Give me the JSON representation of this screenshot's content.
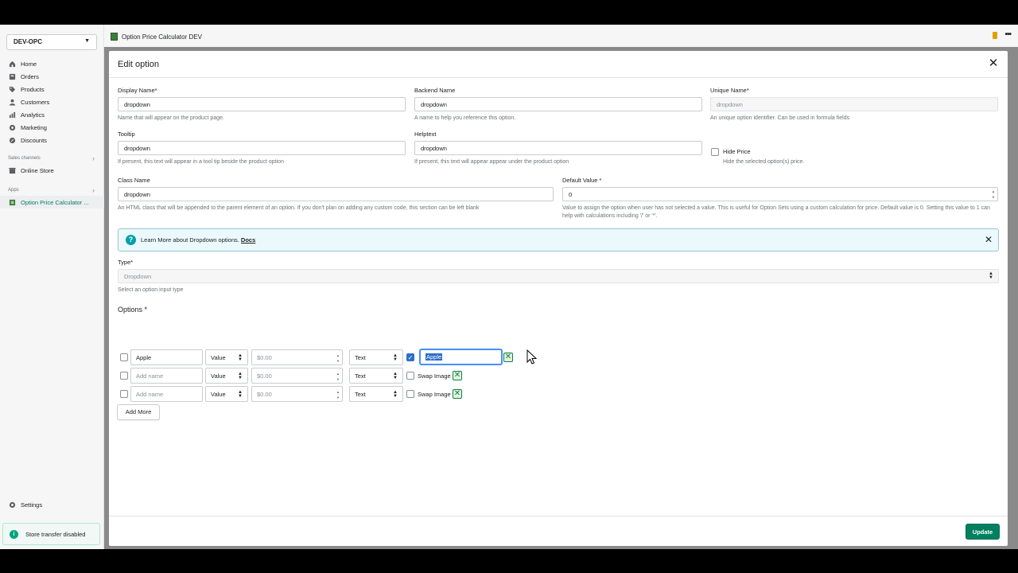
{
  "sidebar": {
    "store": "DEV-OPC",
    "items": [
      {
        "label": "Home",
        "icon": "home-icon"
      },
      {
        "label": "Orders",
        "icon": "orders-icon"
      },
      {
        "label": "Products",
        "icon": "tag-icon"
      },
      {
        "label": "Customers",
        "icon": "person-icon"
      },
      {
        "label": "Analytics",
        "icon": "analytics-icon"
      },
      {
        "label": "Marketing",
        "icon": "marketing-icon"
      },
      {
        "label": "Discounts",
        "icon": "discount-icon"
      }
    ],
    "sales_channels_label": "Sales channels",
    "online_store": "Online Store",
    "apps_label": "Apps",
    "app_item": "Option Price Calculator ...",
    "settings": "Settings",
    "store_transfer": "Store transfer disabled"
  },
  "appbar": {
    "title": "Option Price Calculator DEV"
  },
  "modal": {
    "title": "Edit option",
    "display_name": {
      "label": "Display Name*",
      "value": "dropdown",
      "help": "Name that will appear on the product page."
    },
    "backend_name": {
      "label": "Backend Name",
      "value": "dropdown",
      "help": "A name to help you reference this option."
    },
    "unique_name": {
      "label": "Unique Name*",
      "value": "dropdown",
      "help": "An unique option identifier. Can be used in formula fields"
    },
    "tooltip": {
      "label": "Tooltip",
      "value": "dropdown",
      "help": "If present, this text will appear in a tool tip beside the product option"
    },
    "helptext": {
      "label": "Helptext",
      "value": "dropdown",
      "help": "If present, this text will appear appear under the product option"
    },
    "hide_price": {
      "label": "Hide Price",
      "help": "Hide the selected option(s) price."
    },
    "class_name": {
      "label": "Class Name",
      "value": "dropdown",
      "help": "An HTML class that will be appended to the parent element of an option. If you don't plan on adding any custom code, this section can be left blank"
    },
    "default_value": {
      "label": "Default Value *",
      "value": "0",
      "help": "Value to assign the option when user has not selected a value. This is useful for Option Sets using a custom calculation for price. Default value is 0. Setting this value to 1 can help with calculations including '/' or '*'."
    },
    "banner": {
      "text": "Learn More about Dropdown options.",
      "link": "Docs"
    },
    "type": {
      "label": "Type*",
      "value": "Dropdown",
      "help": "Select an option input type"
    },
    "options_label": "Options *",
    "options": [
      {
        "name": "Apple",
        "name_placeholder": "Add name",
        "mode": "Value",
        "price_placeholder": "$0.00",
        "kind": "Text",
        "swap_checked": true,
        "swap_value": "Apple"
      },
      {
        "name": "",
        "name_placeholder": "Add name",
        "mode": "Value",
        "price_placeholder": "$0.00",
        "kind": "Text",
        "swap_checked": false,
        "swap_label": "Swap Image"
      },
      {
        "name": "",
        "name_placeholder": "Add name",
        "mode": "Value",
        "price_placeholder": "$0.00",
        "kind": "Text",
        "swap_checked": false,
        "swap_label": "Swap Image"
      }
    ],
    "add_more": "Add More",
    "update": "Update"
  },
  "colors": {
    "primary": "#008060",
    "accent_blue": "#2c6ecb",
    "banner_bg": "#ebf9fc"
  }
}
